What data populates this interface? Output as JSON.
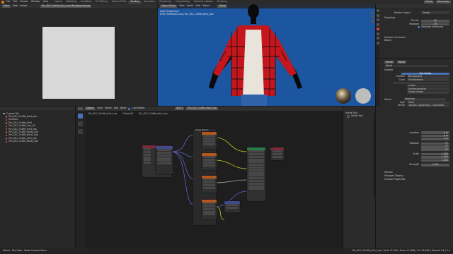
{
  "menubar": {
    "menus": [
      "File",
      "Edit",
      "Render",
      "Window",
      "Help"
    ],
    "workspaces": [
      "Layout",
      "Modeling",
      "Sculpting",
      "UV Editing",
      "Texture Paint",
      "Shading",
      "Animation",
      "Rendering",
      "Compositing",
      "Geometry Nodes",
      "Scripting"
    ],
    "active_workspace": "Shading",
    "scene": "Scene",
    "view_layer": "View Layer"
  },
  "image_editor": {
    "mode": "View",
    "menus": [
      "View",
      "Image"
    ],
    "image_name": "Rin_DLC_Outfit_shirt_Low_Background.png"
  },
  "viewport": {
    "mode": "Object Mode",
    "menus": [
      "View",
      "Select",
      "Add",
      "Object"
    ],
    "overlay_title": "User Perspective",
    "overlay_sub": "(350) Prefabriel Low | Rin_DLC_Outfit_shirt_Low",
    "shading_tabs": [
      "Layout",
      "Global"
    ]
  },
  "outliner": {
    "title": "Current File",
    "items": [
      {
        "label": "Rin_DLC_Outfit_shirt_low",
        "color": "#c8574b"
      },
      {
        "label": "Brushes",
        "color": "#c8574b"
      },
      {
        "label": "Rin_DLC_Outfit_shirt",
        "color": "#c8574b"
      },
      {
        "label": "Rin_DLC_Outfit_Low_01",
        "color": "#c8574b"
      },
      {
        "label": "Rin_DLC_Outfit_shirt_low",
        "color": "#c8574b"
      },
      {
        "label": "Rin_DLC_Outfit_pants_low",
        "color": "#c8574b"
      },
      {
        "label": "Rin_DLC_Outfit_shirt2_low",
        "color": "#c8574b"
      },
      {
        "label": "Rin_DLC_Outfit_skirt_low",
        "color": "#c8574b"
      },
      {
        "label": "Rin_DLC_Outfit_boots_low",
        "color": "#c8574b"
      }
    ]
  },
  "node_editor": {
    "menus": [
      "Object",
      "View",
      "Select",
      "Add",
      "Node"
    ],
    "use_nodes": "Use Nodes",
    "slot": "Slot 1",
    "material": "Rin_DLC_Outfit_shirt_Low",
    "breadcrumb": [
      "Rin_DLC_Outfit_shirt_Low",
      "Object(3)",
      "Rin_DLC_Outfit_shirt_Low"
    ],
    "node_frame_title": "Image Texture"
  },
  "npanel": {
    "title": "Active Tool",
    "tool_label": "Select Box"
  },
  "properties": {
    "render_engine_label": "Render Engine",
    "render_engine": "Eevee",
    "sampling": "Sampling",
    "render_label": "Render",
    "render_val": "64",
    "viewport_label": "Viewport",
    "viewport_val": "16",
    "denoise": "Viewport Denoising",
    "ambient": "Ambient Occlusion",
    "bloom": "Bloom",
    "scene_label": "Scene",
    "world_label": "World",
    "surface_header": "Surface",
    "use_nodes_btn": "Use Nodes",
    "surface_label": "Surface",
    "surface_val": "Background",
    "color_label": "Color",
    "color_val": "Environment",
    "env_sub1": "Linear",
    "env_sub2": "Equirectangular",
    "env_sub3": "Single Image",
    "vector_label": "Vector",
    "vector_val": "Mapping",
    "type_label": "Type",
    "type_val": "Point",
    "vec_label": "Vector",
    "vec_val": "Texture Coordinate | Generated",
    "location_label": "Location",
    "rotation_label": "Rotation",
    "scale_label": "Scale",
    "strength_label": "Strength",
    "strength_val": "1.000",
    "volume": "Volume",
    "viewport_display": "Viewport Display",
    "custom_props": "Custom Properties",
    "loc_vals": [
      "0 m",
      "0 m",
      "0 m"
    ],
    "rot_vals": [
      "0°",
      "0°",
      "0°"
    ],
    "scale_vals": [
      "1.000",
      "1.000",
      "1.000"
    ]
  },
  "status": {
    "left": "Select  ·  Pan View  ·  Node Context Menu",
    "right": "Rin_DLC_Outfit_shirt_Low | Verts 12,345 | Faces 11,808 | Tris 23,616 | Objects 1/9 | 3.4"
  }
}
